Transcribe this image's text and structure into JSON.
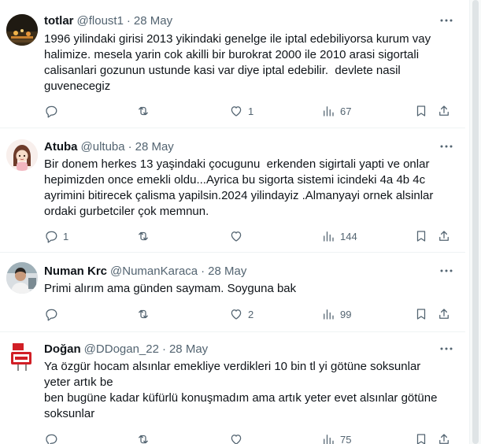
{
  "tweets": [
    {
      "name": "totlar",
      "handle": "@floust1",
      "sep": "·",
      "date": "28 May",
      "text": "1996 yilindaki girisi 2013 yikindaki genelge ile iptal edebiliyorsa kurum vay\nhalimize. mesela yarin cok akilli bir burokrat 2000 ile 2010 arasi sigortali\ncalisanlari gozunun ustunde kasi var diye iptal edebilir.  devlete nasil\nguvenecegiz",
      "replies": "",
      "retweets": "",
      "likes": "1",
      "views": "67",
      "avatar": "night-city-avatar"
    },
    {
      "name": "Atuba",
      "handle": "@ultuba",
      "sep": "·",
      "date": "28 May",
      "text": "Bir donem herkes 13 yaşindaki çocugunu  erkenden sigirtali yapti ve onlar\nhepimizden once emekli oldu...Ayrica bu sigorta sistemi icindeki 4a 4b 4c\nayrimini bitirecek çalisma yapilsin.2024 yilindayiz .Almanyayi ornek alsinlar\nordaki gurbetciler çok memnun.",
      "replies": "1",
      "retweets": "",
      "likes": "",
      "views": "144",
      "avatar": "cartoon-girl-avatar"
    },
    {
      "name": "Numan Krc",
      "handle": "@NumanKaraca",
      "sep": "·",
      "date": "28 May",
      "text": "Primi alırım ama günden saymam. Soyguna bak",
      "replies": "",
      "retweets": "",
      "likes": "2",
      "views": "99",
      "avatar": "man-photo-avatar"
    },
    {
      "name": "Doğan",
      "handle": "@DDogan_22",
      "sep": "·",
      "date": "28 May",
      "text": "Ya özgür hocam alsınlar emekliye verdikleri 10 bin tl yi götüne soksunlar\nyeter artık be\nben bugüne kadar küfürlü konuşmadım ama artık yeter evet alsınlar götüne\nsoksunlar",
      "replies": "",
      "retweets": "",
      "likes": "",
      "views": "75",
      "avatar": "sell-sold-sign-avatar"
    }
  ],
  "colors": {
    "text": "#0f1419",
    "secondary": "#536471",
    "divider": "#eff3f4"
  }
}
